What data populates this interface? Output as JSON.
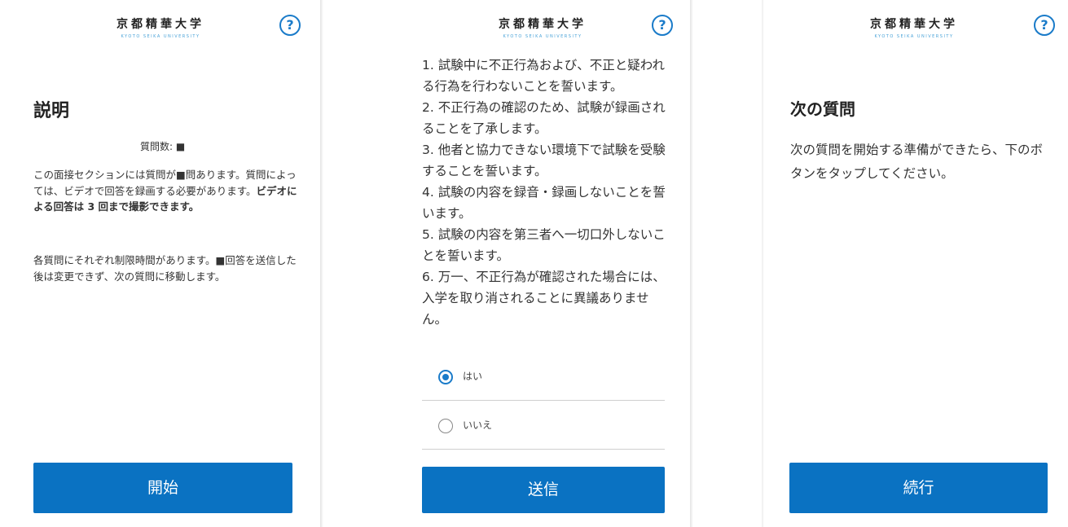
{
  "logo": {
    "title": "京都精華大学",
    "subtitle": "KYOTO SEIKA UNIVERSITY"
  },
  "help": {
    "symbol": "?"
  },
  "colors": {
    "accent": "#0a72c2",
    "help_icon": "#1a7bc9",
    "logo_subtitle": "#4aa3d8"
  },
  "panel1": {
    "heading": "説明",
    "question_count": "質問数: ■",
    "paragraph1_normal": "この面接セクションには質問が■問あります。質問によっては、ビデオで回答を録画する必要があります。",
    "paragraph1_bold": "ビデオによる回答は 3 回まで撮影できます。",
    "paragraph2": "各質問にそれぞれ制限時間があります。■回答を送信した後は変更できず、次の質問に移動します。",
    "button_label": "開始"
  },
  "panel2": {
    "pledges": [
      "1. 試験中に不正行為および、不正と疑われる行為を行わないことを誓います。",
      "2. 不正行為の確認のため、試験が録画されることを了承します。",
      "3. 他者と協力できない環境下で試験を受験することを誓います。",
      "4. 試験の内容を録音・録画しないことを誓います。",
      "5. 試験の内容を第三者へ一切口外しないことを誓います。",
      "6. 万一、不正行為が確認された場合には、入学を取り消されることに異議ありません。"
    ],
    "options": [
      {
        "label": "はい",
        "selected": true
      },
      {
        "label": "いいえ",
        "selected": false
      }
    ],
    "button_label": "送信"
  },
  "panel3": {
    "heading": "次の質問",
    "text": "次の質問を開始する準備ができたら、下のボタンをタップしてください。",
    "button_label": "続行"
  }
}
